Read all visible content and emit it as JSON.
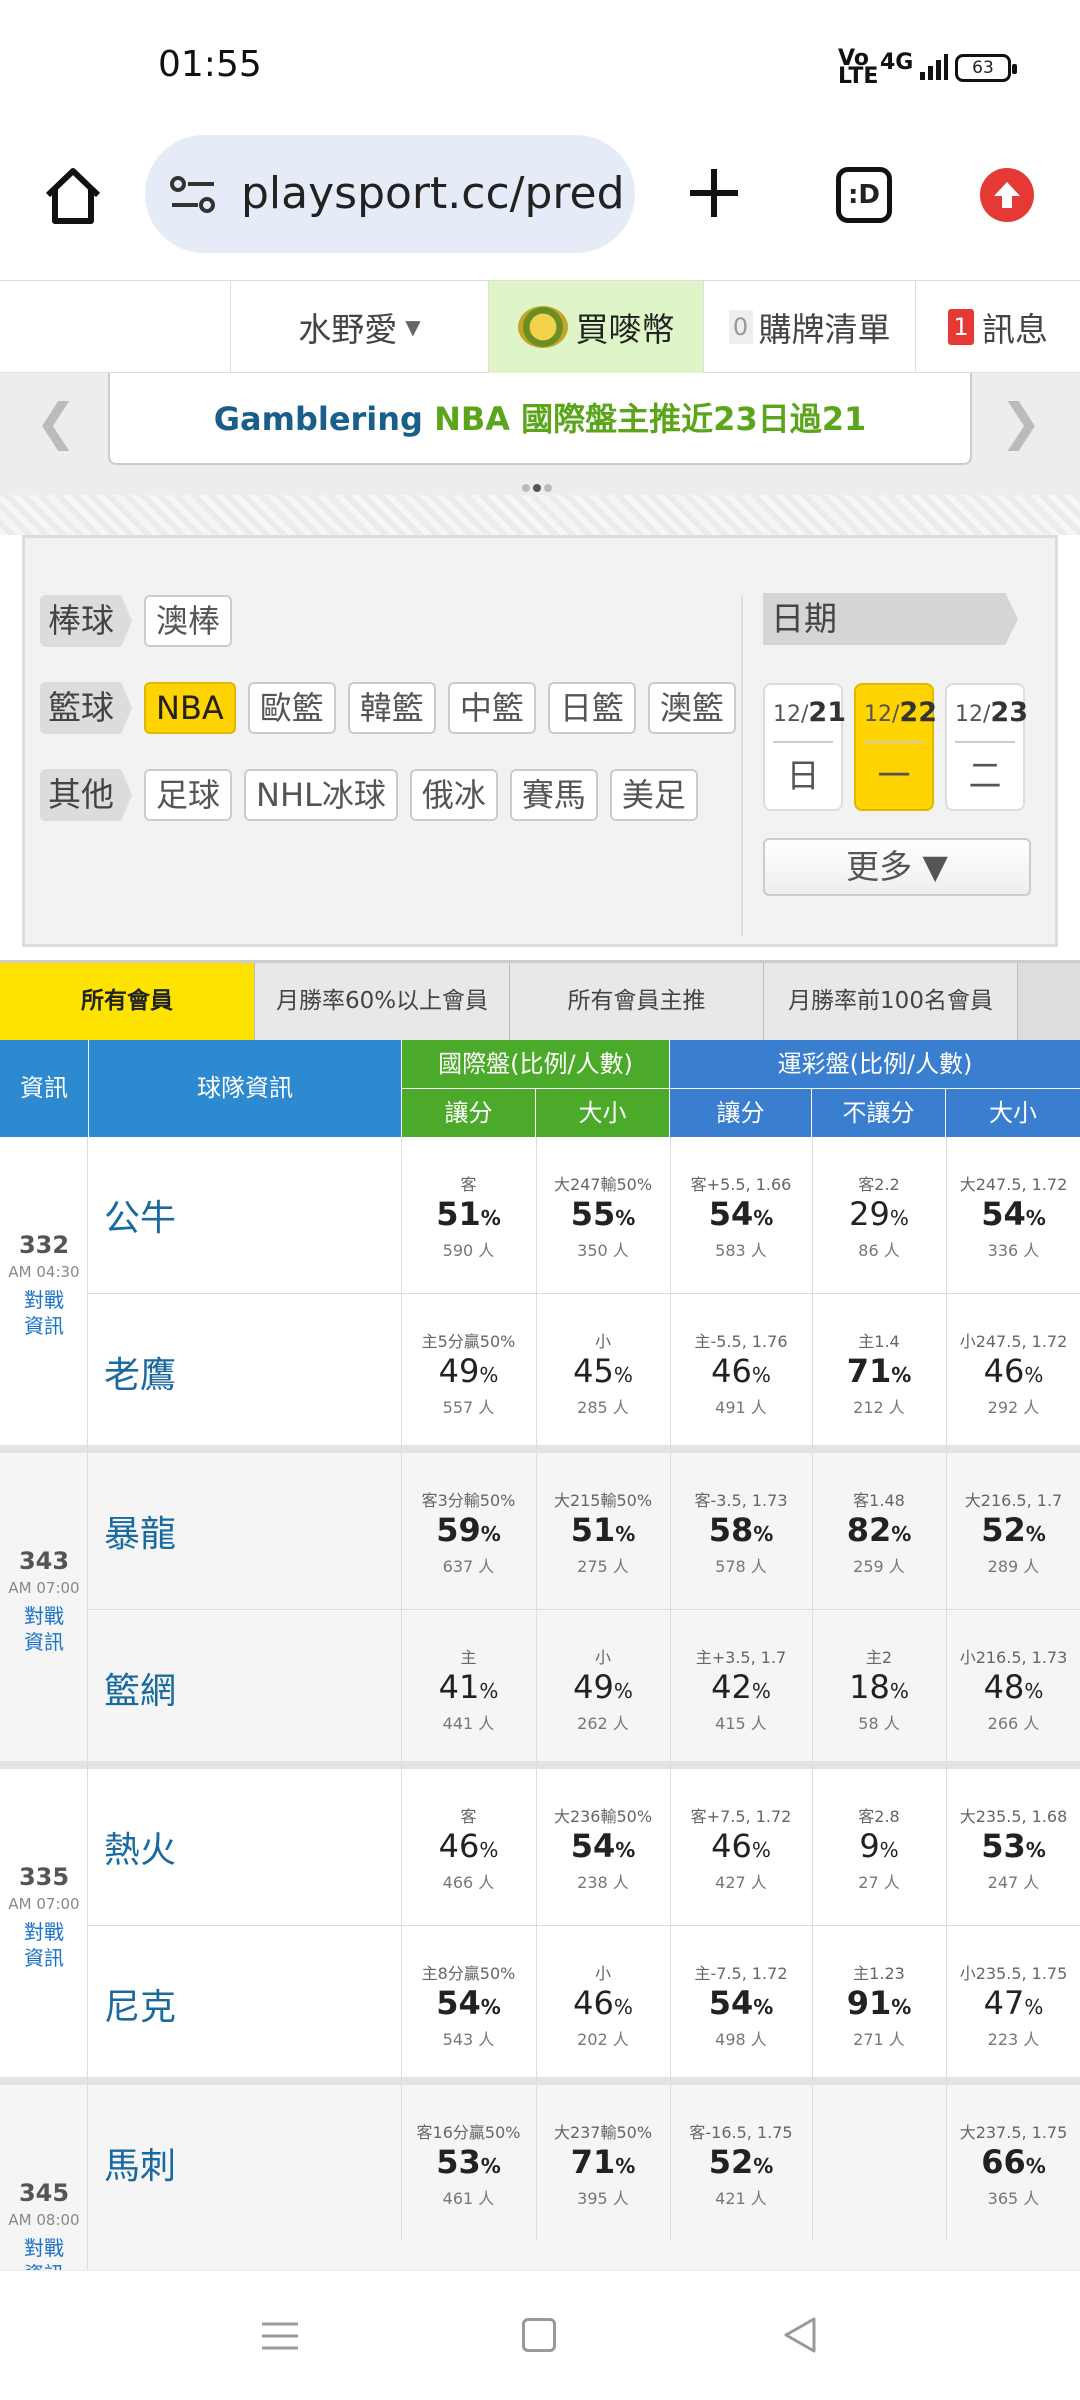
{
  "status_bar": {
    "time": "01:55",
    "signal_text": "Vo\nLTE",
    "network": "4G",
    "battery": "63"
  },
  "browser": {
    "url": "playsport.cc/pred",
    "tabs_icon_label": ":D"
  },
  "topnav": {
    "user": "水野愛",
    "buy": "買嘜幣",
    "list_count": "0",
    "list": "購牌清單",
    "msg_count": "1",
    "msg": "訊息"
  },
  "banner": {
    "part1": "Gamblering",
    "part2": "NBA 國際盤主推近23日過21"
  },
  "filters": {
    "baseball": {
      "label": "棒球",
      "tags": [
        "澳棒"
      ]
    },
    "basketball": {
      "label": "籃球",
      "tags": [
        "NBA",
        "歐籃",
        "韓籃",
        "中籃",
        "日籃",
        "澳籃"
      ]
    },
    "other": {
      "label": "其他",
      "tags": [
        "足球",
        "NHL冰球",
        "俄冰",
        "賽馬",
        "美足"
      ]
    },
    "date_label": "日期",
    "dates": [
      {
        "md": "12/",
        "d": "21",
        "wd": "日"
      },
      {
        "md": "12/",
        "d": "22",
        "wd": "一"
      },
      {
        "md": "12/",
        "d": "23",
        "wd": "二"
      }
    ],
    "more": "更多 ▼"
  },
  "member_tabs": [
    "所有會員",
    "月勝率60%以上會員",
    "所有會員主推",
    "月勝率前100名會員"
  ],
  "table_header": {
    "info": "資訊",
    "team_info": "球隊資訊",
    "intl": "國際盤(比例/人數)",
    "sports_lottery": "運彩盤(比例/人數)",
    "spread": "讓分",
    "total": "大小",
    "spread2": "讓分",
    "moneyline": "不讓分",
    "total2": "大小"
  },
  "games": [
    {
      "num": "332",
      "time": "AM 04:30",
      "link": "對戰\n資訊",
      "teams": [
        {
          "name": "公牛",
          "cells": [
            {
              "lbl": "客",
              "pct": "51",
              "bold": true,
              "ppl": "590 人"
            },
            {
              "lbl": "大247輸50%",
              "pct": "55",
              "bold": true,
              "ppl": "350 人"
            },
            {
              "lbl": "客+5.5, 1.66",
              "pct": "54",
              "bold": true,
              "ppl": "583 人"
            },
            {
              "lbl": "客2.2",
              "pct": "29",
              "bold": false,
              "ppl": "86 人"
            },
            {
              "lbl": "大247.5, 1.72",
              "pct": "54",
              "bold": true,
              "ppl": "336 人"
            }
          ]
        },
        {
          "name": "老鷹",
          "cells": [
            {
              "lbl": "主5分贏50%",
              "pct": "49",
              "bold": false,
              "ppl": "557 人"
            },
            {
              "lbl": "小",
              "pct": "45",
              "bold": false,
              "ppl": "285 人"
            },
            {
              "lbl": "主-5.5, 1.76",
              "pct": "46",
              "bold": false,
              "ppl": "491 人"
            },
            {
              "lbl": "主1.4",
              "pct": "71",
              "bold": true,
              "ppl": "212 人"
            },
            {
              "lbl": "小247.5, 1.72",
              "pct": "46",
              "bold": false,
              "ppl": "292 人"
            }
          ]
        }
      ]
    },
    {
      "num": "343",
      "time": "AM 07:00",
      "link": "對戰\n資訊",
      "teams": [
        {
          "name": "暴龍",
          "cells": [
            {
              "lbl": "客3分輸50%",
              "pct": "59",
              "bold": true,
              "ppl": "637 人"
            },
            {
              "lbl": "大215輸50%",
              "pct": "51",
              "bold": true,
              "ppl": "275 人"
            },
            {
              "lbl": "客-3.5, 1.73",
              "pct": "58",
              "bold": true,
              "ppl": "578 人"
            },
            {
              "lbl": "客1.48",
              "pct": "82",
              "bold": true,
              "ppl": "259 人"
            },
            {
              "lbl": "大216.5, 1.7",
              "pct": "52",
              "bold": true,
              "ppl": "289 人"
            }
          ]
        },
        {
          "name": "籃網",
          "cells": [
            {
              "lbl": "主",
              "pct": "41",
              "bold": false,
              "ppl": "441 人"
            },
            {
              "lbl": "小",
              "pct": "49",
              "bold": false,
              "ppl": "262 人"
            },
            {
              "lbl": "主+3.5, 1.7",
              "pct": "42",
              "bold": false,
              "ppl": "415 人"
            },
            {
              "lbl": "主2",
              "pct": "18",
              "bold": false,
              "ppl": "58 人"
            },
            {
              "lbl": "小216.5, 1.73",
              "pct": "48",
              "bold": false,
              "ppl": "266 人"
            }
          ]
        }
      ]
    },
    {
      "num": "335",
      "time": "AM 07:00",
      "link": "對戰\n資訊",
      "teams": [
        {
          "name": "熱火",
          "cells": [
            {
              "lbl": "客",
              "pct": "46",
              "bold": false,
              "ppl": "466 人"
            },
            {
              "lbl": "大236輸50%",
              "pct": "54",
              "bold": true,
              "ppl": "238 人"
            },
            {
              "lbl": "客+7.5, 1.72",
              "pct": "46",
              "bold": false,
              "ppl": "427 人"
            },
            {
              "lbl": "客2.8",
              "pct": "9",
              "bold": false,
              "ppl": "27 人"
            },
            {
              "lbl": "大235.5, 1.68",
              "pct": "53",
              "bold": true,
              "ppl": "247 人"
            }
          ]
        },
        {
          "name": "尼克",
          "cells": [
            {
              "lbl": "主8分贏50%",
              "pct": "54",
              "bold": true,
              "ppl": "543 人"
            },
            {
              "lbl": "小",
              "pct": "46",
              "bold": false,
              "ppl": "202 人"
            },
            {
              "lbl": "主-7.5, 1.72",
              "pct": "54",
              "bold": true,
              "ppl": "498 人"
            },
            {
              "lbl": "主1.23",
              "pct": "91",
              "bold": true,
              "ppl": "271 人"
            },
            {
              "lbl": "小235.5, 1.75",
              "pct": "47",
              "bold": false,
              "ppl": "223 人"
            }
          ]
        }
      ]
    },
    {
      "num": "345",
      "time": "AM 08:00",
      "link": "對戰\n資訊",
      "teams": [
        {
          "name": "馬刺",
          "cells": [
            {
              "lbl": "客16分贏50%",
              "pct": "53",
              "bold": true,
              "ppl": "461 人"
            },
            {
              "lbl": "大237輸50%",
              "pct": "71",
              "bold": true,
              "ppl": "395 人"
            },
            {
              "lbl": "客-16.5, 1.75",
              "pct": "52",
              "bold": true,
              "ppl": "421 人"
            },
            {
              "lbl": "",
              "pct": "",
              "bold": false,
              "ppl": ""
            },
            {
              "lbl": "大237.5, 1.75",
              "pct": "66",
              "bold": true,
              "ppl": "365 人"
            }
          ]
        }
      ]
    }
  ]
}
